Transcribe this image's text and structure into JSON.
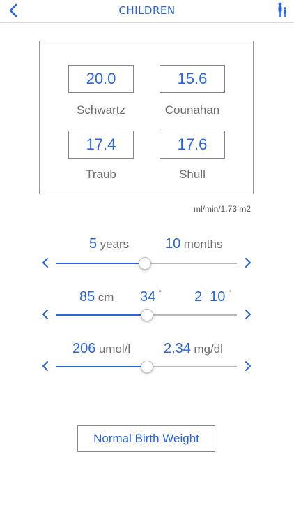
{
  "header": {
    "title": "CHILDREN",
    "back_icon": "chevron-left-icon",
    "right_icon": "person-icon",
    "accent": "#2a64e0"
  },
  "results": [
    {
      "value": "20.0",
      "label": "Schwartz"
    },
    {
      "value": "15.6",
      "label": "Counahan"
    },
    {
      "value": "17.4",
      "label": "Traub"
    },
    {
      "value": "17.6",
      "label": "Shull"
    }
  ],
  "units": "ml/min/1.73 m2",
  "age": {
    "years_value": "5",
    "years_unit": "years",
    "months_value": "10",
    "months_unit": "months",
    "level": 0.49
  },
  "height": {
    "cm_value": "85",
    "cm_unit": "cm",
    "in_value": "34",
    "in_unit": "\"",
    "ft_value": "2",
    "ft_unit": "'",
    "ftin_value": "10",
    "ftin_unit": "\"",
    "level": 0.5
  },
  "creatinine": {
    "umol_value": "206",
    "umol_unit": "umol/l",
    "mg_value": "2.34",
    "mg_unit": "mg/dl",
    "level": 0.5
  },
  "button": {
    "label": "Normal Birth Weight"
  }
}
